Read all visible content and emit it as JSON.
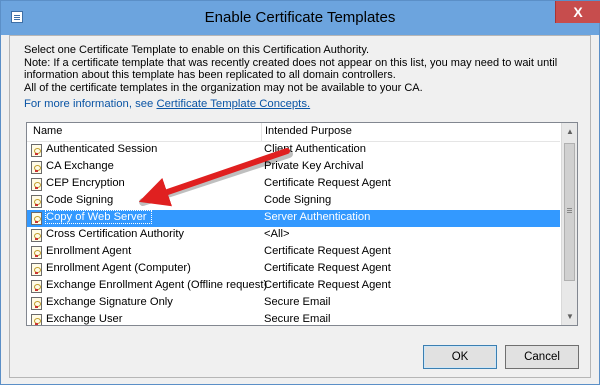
{
  "window": {
    "title": "Enable Certificate Templates",
    "close_label": "X"
  },
  "description": {
    "lines": [
      "Select one Certificate Template to enable on this Certification Authority.",
      "Note: If a certificate template that was recently created does not appear on this list, you may need to wait until",
      "information about this template has been replicated to all domain controllers.",
      "All of the certificate templates in the organization may not be available to your CA."
    ],
    "more_info_prefix": "For more information, see ",
    "more_info_link": "Certificate Template Concepts."
  },
  "list": {
    "columns": [
      "Name",
      "Intended Purpose"
    ],
    "selected_index": 4,
    "rows": [
      {
        "name": "Authenticated Session",
        "purpose": "Client Authentication"
      },
      {
        "name": "CA Exchange",
        "purpose": "Private Key Archival"
      },
      {
        "name": "CEP Encryption",
        "purpose": "Certificate Request Agent"
      },
      {
        "name": "Code Signing",
        "purpose": "Code Signing"
      },
      {
        "name": "Copy of Web Server",
        "purpose": "Server Authentication"
      },
      {
        "name": "Cross Certification Authority",
        "purpose": "<All>"
      },
      {
        "name": "Enrollment Agent",
        "purpose": "Certificate Request Agent"
      },
      {
        "name": "Enrollment Agent (Computer)",
        "purpose": "Certificate Request Agent"
      },
      {
        "name": "Exchange Enrollment Agent (Offline request)",
        "purpose": "Certificate Request Agent"
      },
      {
        "name": "Exchange Signature Only",
        "purpose": "Secure Email"
      },
      {
        "name": "Exchange User",
        "purpose": "Secure Email"
      }
    ]
  },
  "buttons": {
    "ok": "OK",
    "cancel": "Cancel"
  },
  "colors": {
    "titlebar": "#6ca4de",
    "selection": "#3399ff",
    "arrow": "#e02020",
    "link": "#0b55a5"
  }
}
